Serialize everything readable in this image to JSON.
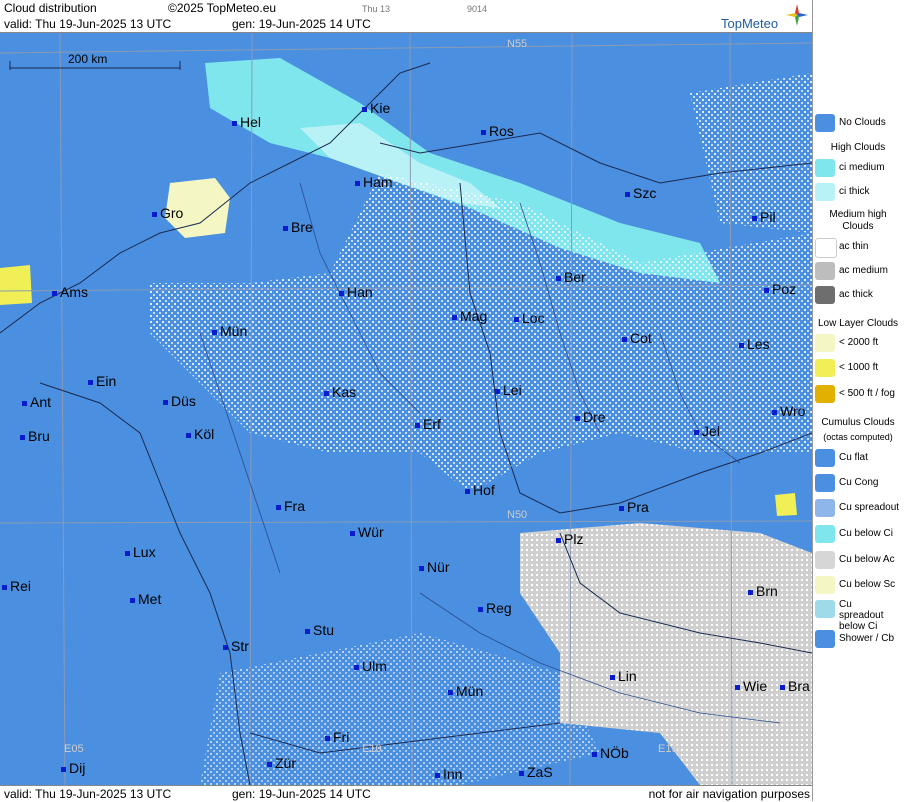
{
  "header": {
    "title": "Cloud distribution",
    "copyright": "©2025 TopMeteo.eu",
    "small_a": "Thu 13",
    "small_b": "9014",
    "valid": "valid:  Thu  19-Jun-2025  13 UTC",
    "gen": "gen: 19-Jun-2025 14 UTC",
    "brand": "TopMeteo"
  },
  "footer": {
    "valid": "valid:  Thu  19-Jun-2025  13 UTC",
    "gen": "gen: 19-Jun-2025 14 UTC",
    "note": "not for air navigation purposes"
  },
  "map": {
    "scale_label": "200 km",
    "grid_labels": [
      "N55",
      "N50",
      "E05",
      "E10",
      "E15"
    ],
    "cities": [
      "Hel",
      "Kie",
      "Ros",
      "Ham",
      "Szc",
      "Gro",
      "Bre",
      "Pil",
      "Ber",
      "Poz",
      "Ams",
      "Han",
      "Mag",
      "Loc",
      "Cot",
      "Les",
      "Mün",
      "Ein",
      "Kas",
      "Lei",
      "Wro",
      "Ant",
      "Düs",
      "Erf",
      "Dre",
      "Jel",
      "Bru",
      "Köl",
      "Hof",
      "Fra",
      "Pra",
      "Lux",
      "Wür",
      "Plz",
      "Rei",
      "Nür",
      "Met",
      "Reg",
      "Brn",
      "Stu",
      "Str",
      "Ulm",
      "Lin",
      "Wie",
      "Bra",
      "Mün",
      "Fri",
      "NÖb",
      "Dij",
      "Zür",
      "Inn",
      "ZaS"
    ]
  },
  "legend": {
    "no_clouds": "No Clouds",
    "high_head": "High Clouds",
    "ci_medium": "ci medium",
    "ci_thick": "ci thick",
    "med_head": "Medium high Clouds",
    "ac_thin": "ac thin",
    "ac_medium": "ac medium",
    "ac_thick": "ac thick",
    "low_head": "Low Layer Clouds",
    "low_2000": "< 2000 ft",
    "low_1000": "< 1000 ft",
    "low_500": "< 500 ft / fog",
    "cu_head": "Cumulus Clouds",
    "cu_sub": "(octas computed)",
    "cu_flat": "Cu flat",
    "cu_cong": "Cu Cong",
    "cu_spread": "Cu spreadout",
    "cu_below_ci": "Cu below Ci",
    "cu_below_ac": "Cu below Ac",
    "cu_below_sc": "Cu below Sc",
    "cu_spread_ci": "Cu spreadout below Ci",
    "shower": "Shower / Cb",
    "colors": {
      "no_clouds": "#4a8fe0",
      "ci_medium": "#7fe6ee",
      "ci_thick": "#b8f2f6",
      "ac_thin": "#ffffff",
      "ac_medium": "#bdbdbd",
      "ac_thick": "#6e6e6e",
      "low_2000": "#f4f6c4",
      "low_1000": "#f0f056",
      "low_500": "#e2b000"
    }
  }
}
